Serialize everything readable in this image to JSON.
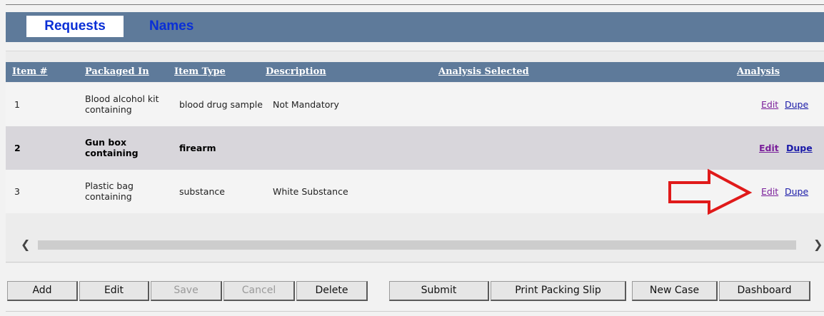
{
  "tabs": {
    "requests": "Requests",
    "names": "Names"
  },
  "columns": {
    "item": "Item #",
    "packaged": "Packaged In",
    "type": "Item Type",
    "description": "Description",
    "analysis_selected": "Analysis Selected",
    "analysis": "Analysis"
  },
  "rows": [
    {
      "item": "1",
      "packaged_line1": "Blood alcohol kit",
      "packaged_line2": "containing",
      "type": "blood drug sample",
      "description": "Not Mandatory",
      "edit": "Edit",
      "dupe": "Dupe"
    },
    {
      "item": "2",
      "packaged_line1": "Gun box",
      "packaged_line2": "containing",
      "type": "firearm",
      "description": "",
      "edit": "Edit",
      "dupe": "Dupe"
    },
    {
      "item": "3",
      "packaged_line1": "Plastic bag",
      "packaged_line2": "containing",
      "type": "substance",
      "description": "White Substance",
      "edit": "Edit",
      "dupe": "Dupe"
    }
  ],
  "buttons": {
    "add": "Add",
    "edit": "Edit",
    "save": "Save",
    "cancel": "Cancel",
    "delete": "Delete",
    "submit": "Submit",
    "print": "Print Packing Slip",
    "new_case": "New Case",
    "dashboard": "Dashboard"
  },
  "colors": {
    "header_bg": "#5e7a9a",
    "link_blue": "#0a2fd6",
    "edit_link": "#7a1f9a",
    "dupe_link": "#1a1aa8",
    "annotation_arrow": "#e01a1a"
  },
  "icons": {
    "scroll_left": "chevron-left-icon",
    "scroll_right": "chevron-right-icon",
    "annotation": "right-arrow-outline-icon"
  }
}
